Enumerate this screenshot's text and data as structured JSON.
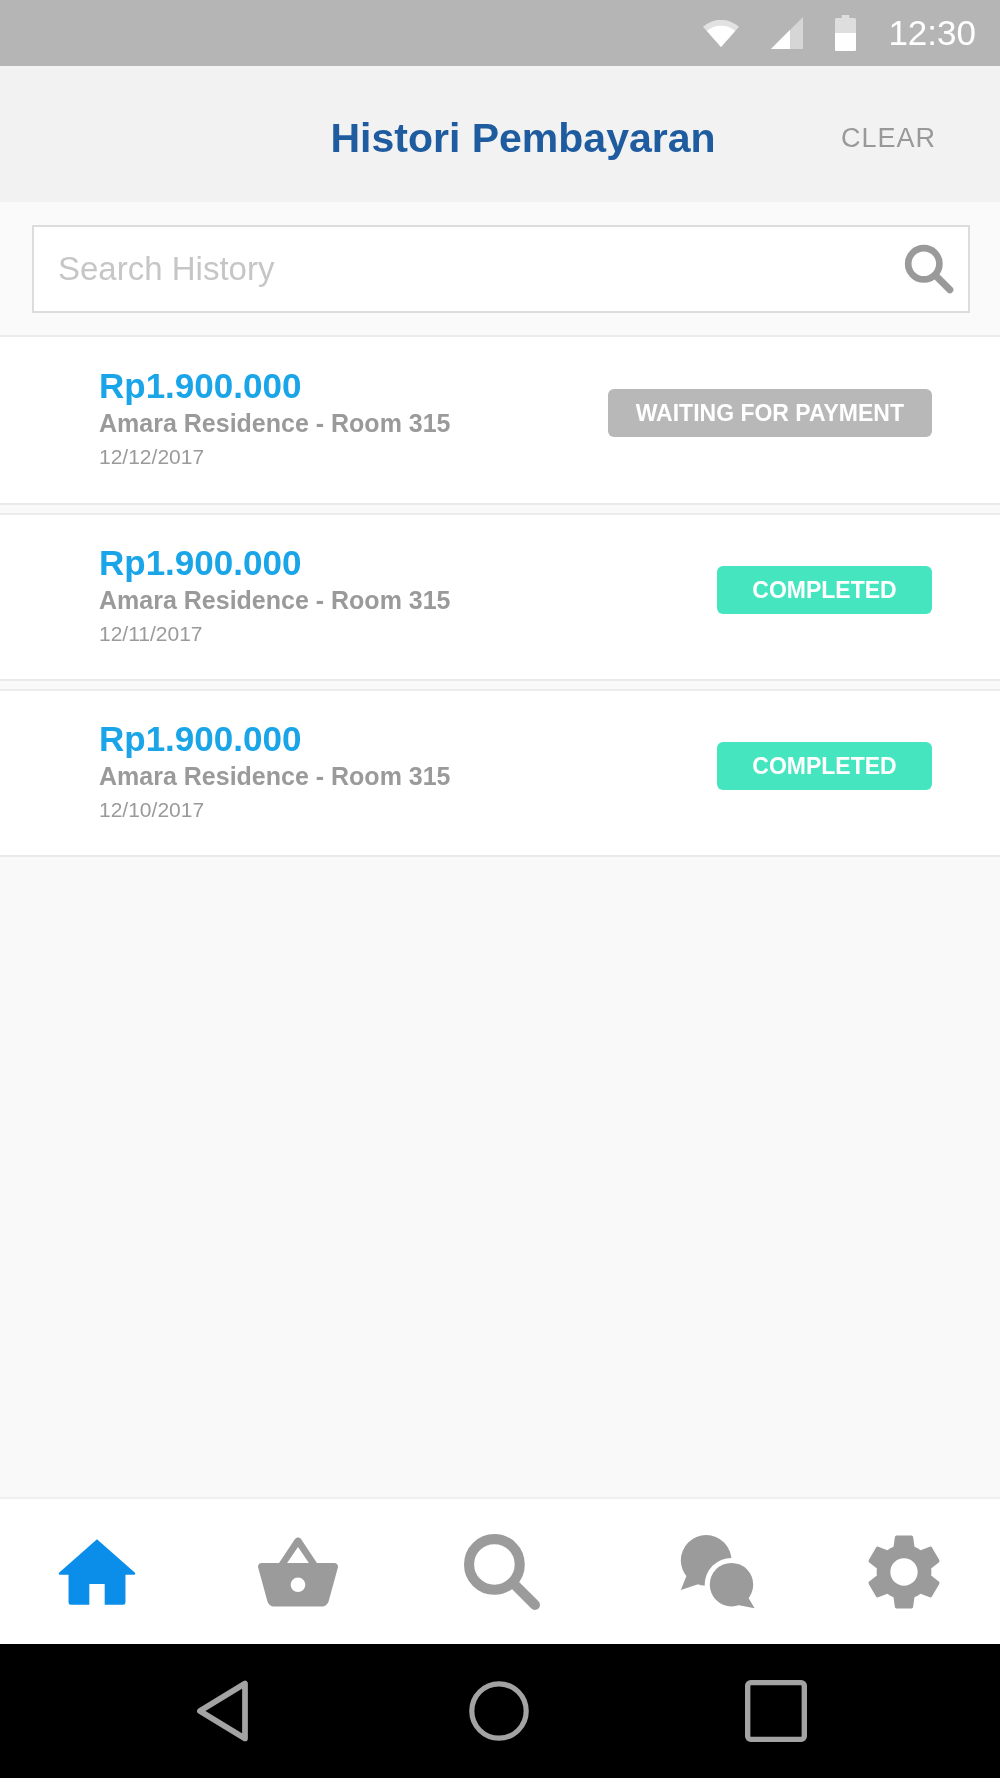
{
  "status_bar": {
    "time": "12:30"
  },
  "header": {
    "title": "Histori Pembayaran",
    "action": "CLEAR"
  },
  "search": {
    "placeholder": "Search History"
  },
  "payments": [
    {
      "amount": "Rp1.900.000",
      "property": "Amara Residence - Room 315",
      "date": "12/12/2017",
      "status": {
        "label": "WAITING FOR PAYMENT",
        "color": "#b8b8b8"
      }
    },
    {
      "amount": "Rp1.900.000",
      "property": "Amara Residence - Room 315",
      "date": "12/11/2017",
      "status": {
        "label": "COMPLETED",
        "color": "#45e6bf"
      }
    },
    {
      "amount": "Rp1.900.000",
      "property": "Amara Residence - Room 315",
      "date": "12/10/2017",
      "status": {
        "label": "COMPLETED",
        "color": "#45e6bf"
      }
    }
  ],
  "bottom_nav": [
    {
      "kind": "home",
      "selected": true
    },
    {
      "kind": "basket",
      "selected": false
    },
    {
      "kind": "search",
      "selected": false
    },
    {
      "kind": "chat",
      "selected": false
    },
    {
      "kind": "settings",
      "selected": false
    }
  ],
  "system_nav": [
    {
      "kind": "back"
    },
    {
      "kind": "home"
    },
    {
      "kind": "recents"
    }
  ]
}
